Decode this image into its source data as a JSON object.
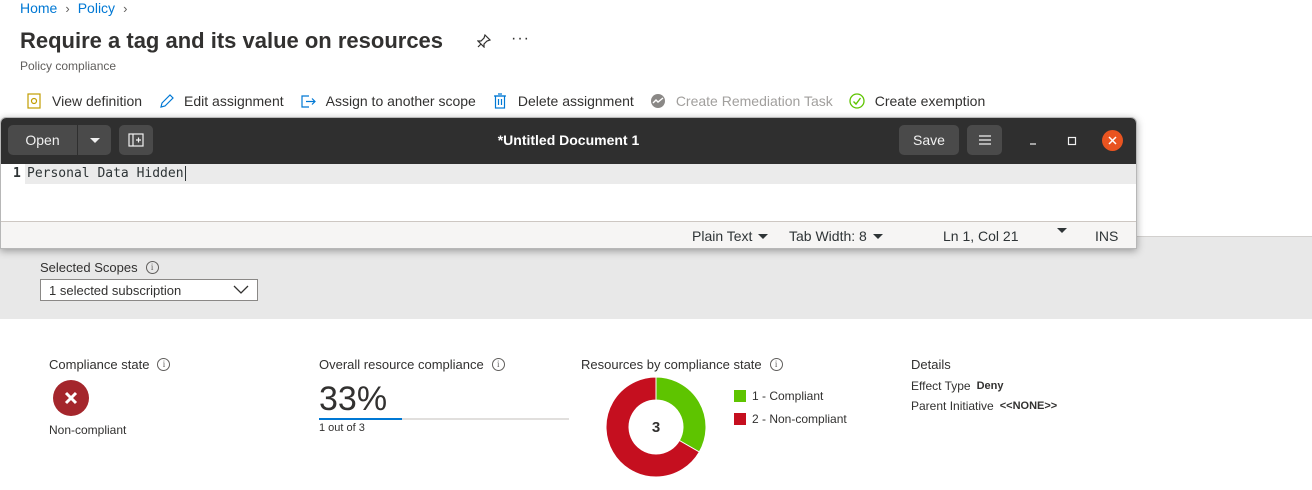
{
  "breadcrumb": {
    "home": "Home",
    "policy": "Policy"
  },
  "page": {
    "title": "Require a tag and its value on resources",
    "subtitle": "Policy compliance"
  },
  "commands": [
    {
      "label": "View definition",
      "icon": "document-icon",
      "disabled": false
    },
    {
      "label": "Edit assignment",
      "icon": "pencil-icon",
      "disabled": false
    },
    {
      "label": "Assign to another scope",
      "icon": "assign-arrow-icon",
      "disabled": false
    },
    {
      "label": "Delete assignment",
      "icon": "trash-icon",
      "disabled": false
    },
    {
      "label": "Create Remediation Task",
      "icon": "remediation-icon",
      "disabled": true
    },
    {
      "label": "Create exemption",
      "icon": "check-circle-icon",
      "disabled": false
    }
  ],
  "editor": {
    "open_label": "Open",
    "doc_title": "*Untitled Document 1",
    "save_label": "Save",
    "line_number": "1",
    "line_text": "Personal Data Hidden",
    "status": {
      "language": "Plain Text",
      "tab_width": "Tab Width: 8",
      "position": "Ln 1, Col 21",
      "mode": "INS"
    }
  },
  "filters": {
    "scopes_label": "Selected Scopes",
    "scopes_value": "1 selected subscription"
  },
  "compliance_state": {
    "label": "Compliance state",
    "value": "Non-compliant"
  },
  "overall": {
    "label": "Overall resource compliance",
    "percent": "33%",
    "percent_value": 33,
    "sub": "1 out of 3"
  },
  "by_state": {
    "label": "Resources by compliance state",
    "total": "3",
    "legend": [
      {
        "label": "1 - Compliant",
        "value": 1,
        "color": "#5ec400"
      },
      {
        "label": "2 - Non-compliant",
        "value": 2,
        "color": "#c50f1f"
      }
    ]
  },
  "details": {
    "title": "Details",
    "effect_label": "Effect Type",
    "effect_value": "Deny",
    "parent_label": "Parent Initiative",
    "parent_value": "<<NONE>>"
  },
  "colors": {
    "link": "#0078d4",
    "header_bar": "#2f2f2f",
    "close": "#e95420",
    "error": "#a4262c"
  }
}
